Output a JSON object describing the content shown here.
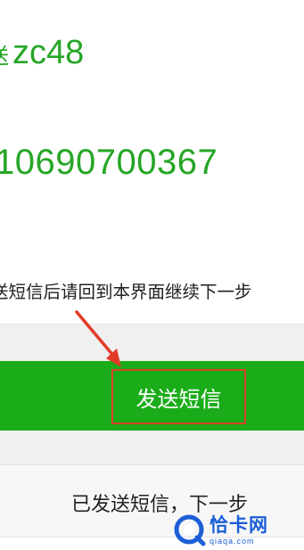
{
  "sms": {
    "code_prefix": "送",
    "code": "zc48",
    "number": "10690700367",
    "instruction": "送短信后请回到本界面继续下一步"
  },
  "actions": {
    "send_sms_label": "发送短信",
    "next_step_label": "已发送短信，下一步"
  },
  "watermark": {
    "text": "恰卡网",
    "subtext": "qiaqa.com"
  },
  "colors": {
    "accent_green": "#1aad19",
    "text_green": "#26a626",
    "highlight_red": "#d9412c",
    "watermark_blue": "#1c5fd6"
  }
}
